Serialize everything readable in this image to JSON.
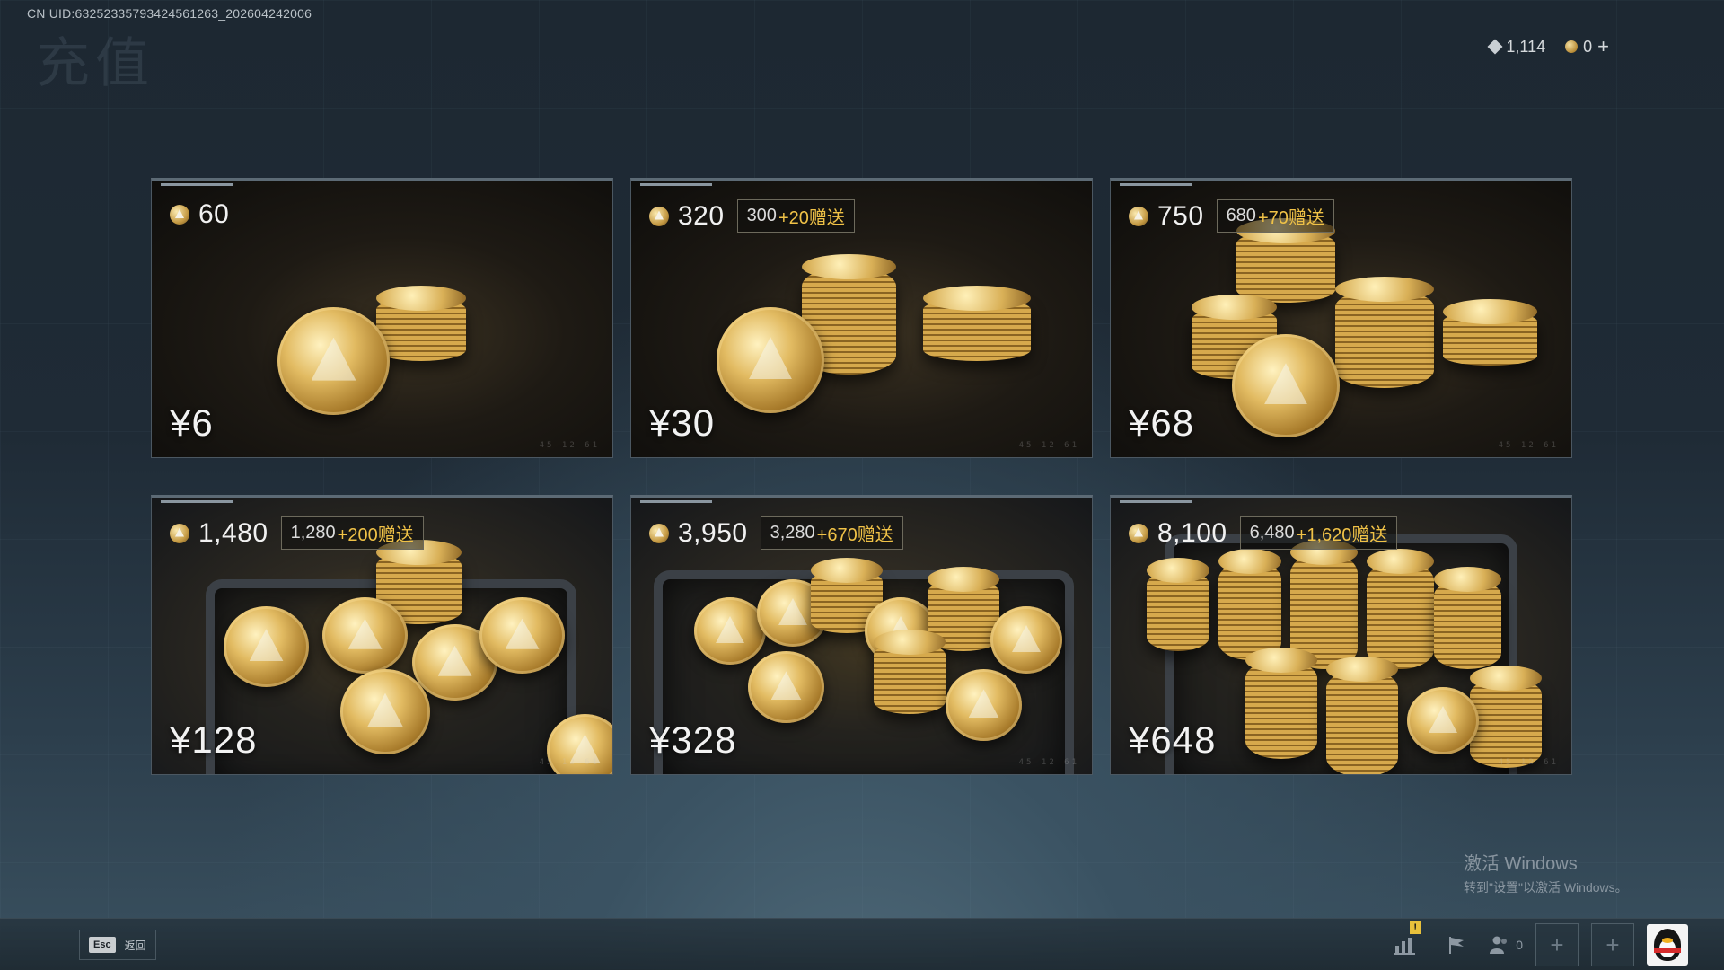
{
  "header": {
    "uid_text": "CN UID:63252335793424561263_202604242006",
    "page_title": "充值",
    "currency": {
      "diamond_amount": "1,114",
      "coin_amount": "0",
      "add_label": "+"
    }
  },
  "packages": [
    {
      "amount": "60",
      "base": "",
      "bonus": "",
      "price": "¥6",
      "style": "pile"
    },
    {
      "amount": "320",
      "base": "300",
      "bonus": "+20赠送",
      "price": "¥30",
      "style": "pile"
    },
    {
      "amount": "750",
      "base": "680",
      "bonus": "+70赠送",
      "price": "¥68",
      "style": "pile"
    },
    {
      "amount": "1,480",
      "base": "1,280",
      "bonus": "+200赠送",
      "price": "¥128",
      "style": "box"
    },
    {
      "amount": "3,950",
      "base": "3,280",
      "bonus": "+670赠送",
      "price": "¥328",
      "style": "box"
    },
    {
      "amount": "8,100",
      "base": "6,480",
      "bonus": "+1,620赠送",
      "price": "¥648",
      "style": "box"
    }
  ],
  "watermark": {
    "line1": "激活 Windows",
    "line2": "转到\"设置\"以激活 Windows。"
  },
  "bottom_bar": {
    "esc_key": "Esc",
    "esc_label": "返回",
    "alert_badge": "!",
    "friends_count": "0",
    "slot_label": "+"
  },
  "colors": {
    "bonus_accent": "#f0c247",
    "background": "#1f2b36"
  }
}
